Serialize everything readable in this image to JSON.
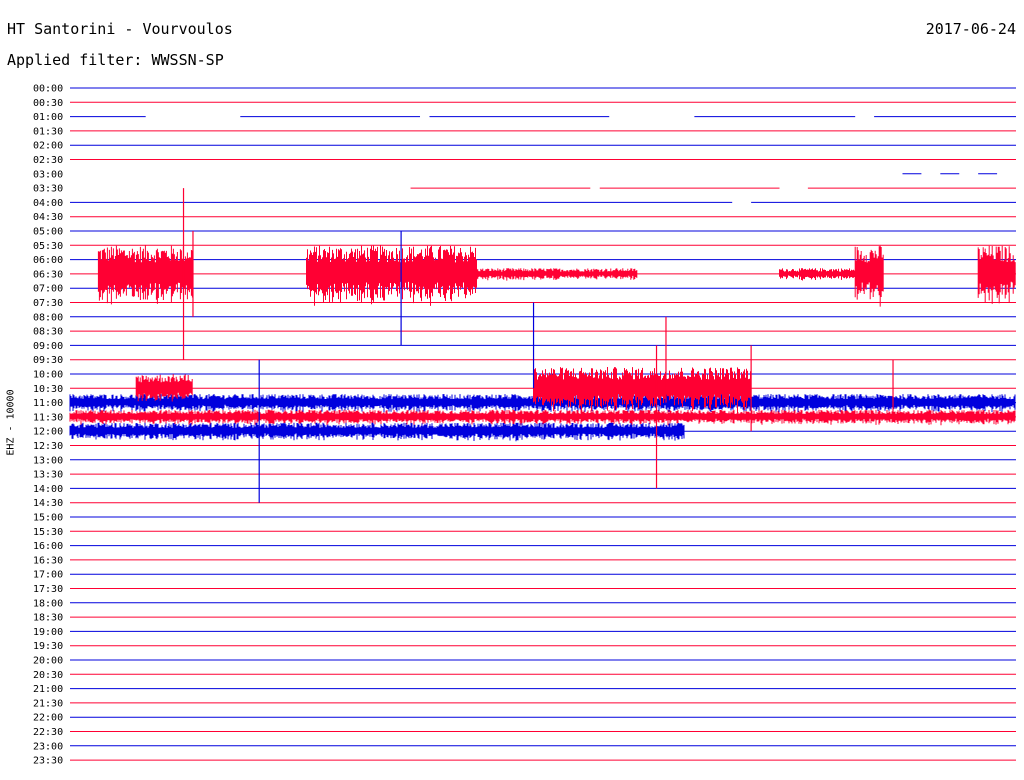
{
  "header": {
    "title": "HT Santorini - Vourvoulos",
    "date": "2017-06-24",
    "filter": "Applied filter: WWSSN-SP"
  },
  "channel": "EHZ - 10000",
  "colors": {
    "odd_trace": "#0000dd",
    "even_trace": "#ff0033",
    "text": "#000000",
    "background": "#ffffff"
  },
  "chart_data": {
    "type": "line",
    "subtype": "helicorder",
    "title": "HT Santorini - Vourvoulos",
    "date": "2017-06-24",
    "ylabel": "EHZ - 10000",
    "row_minutes": 30,
    "row_labels": [
      "00:00",
      "00:30",
      "01:00",
      "01:30",
      "02:00",
      "02:30",
      "03:00",
      "03:30",
      "04:00",
      "04:30",
      "05:00",
      "05:30",
      "06:00",
      "06:30",
      "07:00",
      "07:30",
      "08:00",
      "08:30",
      "09:00",
      "09:30",
      "10:00",
      "10:30",
      "11:00",
      "11:30",
      "12:00",
      "12:30",
      "13:00",
      "13:30",
      "14:00",
      "14:30",
      "15:00",
      "15:30",
      "16:00",
      "16:30",
      "17:00",
      "17:30",
      "18:00",
      "18:30",
      "19:00",
      "19:30",
      "20:00",
      "20:30",
      "21:00",
      "21:30",
      "22:00",
      "22:30",
      "23:00",
      "23:30"
    ],
    "row_colors": [
      "blue",
      "red"
    ],
    "gaps": [
      {
        "row": "01:00",
        "segments": [
          [
            0.0,
            0.08
          ],
          [
            0.18,
            0.37
          ],
          [
            0.38,
            0.57
          ],
          [
            0.66,
            0.83
          ],
          [
            0.85,
            1.0
          ]
        ]
      },
      {
        "row": "03:00",
        "segments": [
          [
            0.88,
            0.9
          ],
          [
            0.92,
            0.94
          ],
          [
            0.96,
            0.98
          ]
        ]
      },
      {
        "row": "03:30",
        "segments": [
          [
            0.36,
            0.55
          ],
          [
            0.56,
            0.75
          ],
          [
            0.78,
            1.0
          ]
        ]
      },
      {
        "row": "04:00",
        "segments": [
          [
            0.0,
            0.7
          ],
          [
            0.72,
            1.0
          ]
        ]
      }
    ],
    "events": [
      {
        "row": "06:30",
        "x": 0.12,
        "amplitude": 6
      },
      {
        "row": "06:30",
        "x": 0.13,
        "amplitude": 3
      },
      {
        "row": "07:00",
        "x": 0.35,
        "amplitude": 4
      },
      {
        "row": "09:00",
        "x": 0.49,
        "amplitude": 3
      },
      {
        "row": "09:30",
        "x": 0.63,
        "amplitude": 3
      },
      {
        "row": "10:30",
        "x": 0.72,
        "amplitude": 3
      },
      {
        "row": "10:30",
        "x": 0.87,
        "amplitude": 2
      },
      {
        "row": "11:30",
        "x": 0.62,
        "amplitude": 5
      },
      {
        "row": "12:00",
        "x": 0.2,
        "amplitude": 5
      }
    ],
    "noisy_bands": [
      {
        "row": "06:30",
        "x_start": 0.03,
        "x_end": 0.13,
        "level": 2
      },
      {
        "row": "06:30",
        "x_start": 0.25,
        "x_end": 0.43,
        "level": 2
      },
      {
        "row": "06:30",
        "x_start": 0.43,
        "x_end": 0.6,
        "level": 0.4
      },
      {
        "row": "06:30",
        "x_start": 0.75,
        "x_end": 0.84,
        "level": 0.4
      },
      {
        "row": "06:30",
        "x_start": 0.83,
        "x_end": 0.86,
        "level": 2
      },
      {
        "row": "06:30",
        "x_start": 0.96,
        "x_end": 1.0,
        "level": 2
      },
      {
        "row": "11:00",
        "x_start": 0.0,
        "x_end": 1.0,
        "level": 0.6
      },
      {
        "row": "11:30",
        "x_start": 0.0,
        "x_end": 1.0,
        "level": 0.5
      },
      {
        "row": "12:00",
        "x_start": 0.0,
        "x_end": 0.65,
        "level": 0.6
      },
      {
        "row": "10:30",
        "x_start": 0.07,
        "x_end": 0.13,
        "level": 1
      },
      {
        "row": "10:30",
        "x_start": 0.49,
        "x_end": 0.72,
        "level": 1.5
      }
    ]
  }
}
